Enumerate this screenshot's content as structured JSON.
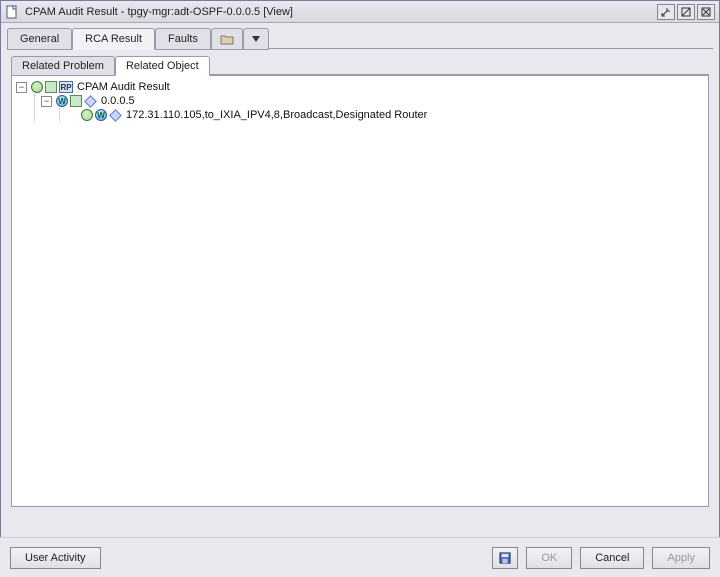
{
  "window": {
    "title": "CPAM Audit Result - tpgy-mgr:adt-OSPF-0.0.0.5 [View]"
  },
  "mainTabs": {
    "general": "General",
    "rca": "RCA Result",
    "faults": "Faults"
  },
  "subTabs": {
    "relatedProblem": "Related Problem",
    "relatedObject": "Related Object"
  },
  "tree": {
    "root": {
      "label": "CPAM Audit Result",
      "badge": "RP"
    },
    "child1": {
      "label": "0.0.0.5",
      "badge": "W"
    },
    "leaf1": {
      "label": "172.31.110.105,to_IXIA_IPV4,8,Broadcast,Designated Router",
      "badge": "W"
    }
  },
  "footer": {
    "userActivity": "User Activity",
    "ok": "OK",
    "cancel": "Cancel",
    "apply": "Apply"
  }
}
